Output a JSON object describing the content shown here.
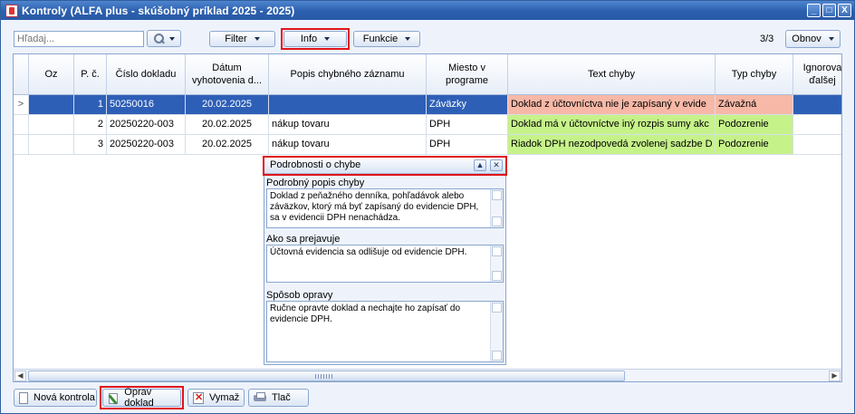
{
  "window": {
    "title": "Kontroly (ALFA plus - skúšobný príklad 2025 - 2025)",
    "buttons": [
      "_",
      "□",
      "X"
    ]
  },
  "toolbar": {
    "search_placeholder": "Hľadaj...",
    "filter_label": "Filter",
    "info_label": "Info",
    "functions_label": "Funkcie",
    "count": "3/3",
    "refresh_label": "Obnov"
  },
  "grid": {
    "columns": [
      "Oz",
      "P. č.",
      "Číslo dokladu",
      "Dátum vyhotovenia d...",
      "Popis chybného záznamu",
      "Miesto v programe",
      "Text chyby",
      "Typ chyby",
      "Ignorova ďalšej"
    ],
    "rows": [
      {
        "indicator": ">",
        "oz": "",
        "pc": "1",
        "doklad": "50250016",
        "datum": "20.02.2025",
        "popis": "",
        "miesto": "Záväzky",
        "text": "Doklad z účtovníctva nie je zapísaný v evide",
        "typ": "Závažná",
        "selected": true,
        "severity": "major"
      },
      {
        "indicator": "",
        "oz": "",
        "pc": "2",
        "doklad": "20250220-003",
        "datum": "20.02.2025",
        "popis": "nákup tovaru",
        "miesto": "DPH",
        "text": "Doklad má v účtovníctve iný rozpis sumy akc",
        "typ": "Podozrenie",
        "selected": false,
        "severity": "suspect"
      },
      {
        "indicator": "",
        "oz": "",
        "pc": "3",
        "doklad": "20250220-003",
        "datum": "20.02.2025",
        "popis": "nákup tovaru",
        "miesto": "DPH",
        "text": "Riadok DPH nezodpovedá zvolenej sadzbe D",
        "typ": "Podozrenie",
        "selected": false,
        "severity": "suspect"
      }
    ]
  },
  "details": {
    "title": "Podrobnosti o chybe",
    "sections": [
      {
        "label": "Podrobný popis chyby",
        "text": "Doklad z peňažného denníka, pohľadávok alebo záväzkov, ktorý má byť zapísaný do evidencie DPH, sa v evidencii DPH nenachádza."
      },
      {
        "label": "Ako sa prejavuje",
        "text": "Účtovná evidencia sa odlišuje od evidencie DPH."
      },
      {
        "label": "Spôsob opravy",
        "text": "Ručne opravte doklad a nechajte ho zapísať do evidencie DPH."
      }
    ]
  },
  "bottom": {
    "new_label": "Nová kontrola",
    "fix_label": "Oprav doklad",
    "delete_label": "Vymaž",
    "print_label": "Tlač"
  },
  "colors": {
    "major_bg": "#f7b8a7",
    "suspect_bg": "#c6f28a",
    "selected_bg": "#2e5fb7",
    "highlight_frame": "#e1141b"
  }
}
